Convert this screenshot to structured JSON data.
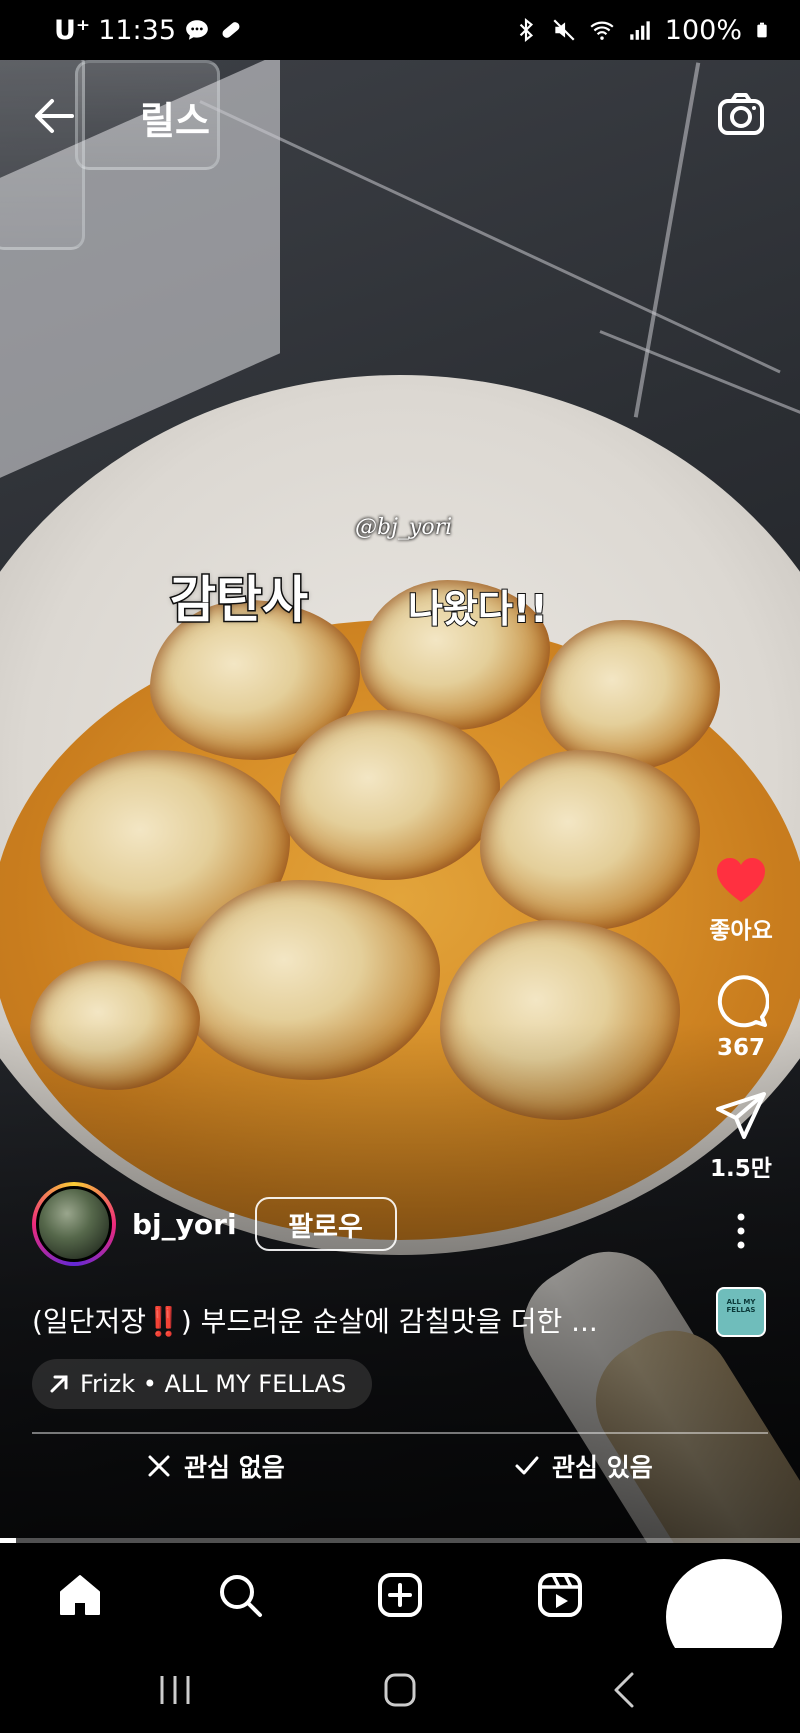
{
  "status_bar": {
    "carrier": "U⁺",
    "time": "11:35",
    "battery": "100%"
  },
  "header": {
    "title": "릴스"
  },
  "video_overlay": {
    "watermark": "@bj_yori",
    "caption_big": "감탄사",
    "caption_small": "나왔다!!"
  },
  "actions": {
    "like_label": "좋아요",
    "comment_count": "367",
    "share_count": "1.5만"
  },
  "author": {
    "username": "bj_yori",
    "follow_label": "팔로우"
  },
  "post": {
    "caption": "(일단저장‼️) 부드러운 순살에 감칠맛을 더한 ...",
    "audio": "Frizk • ALL MY FELLAS",
    "audio_thumb_text": "ALL MY FELLAS"
  },
  "feedback": {
    "not_interested": "관심 없음",
    "interested": "관심 있음"
  },
  "playback": {
    "progress_fraction": 0.02
  },
  "colors": {
    "like": "#ff3040",
    "background": "#000000",
    "text": "#ffffff"
  }
}
